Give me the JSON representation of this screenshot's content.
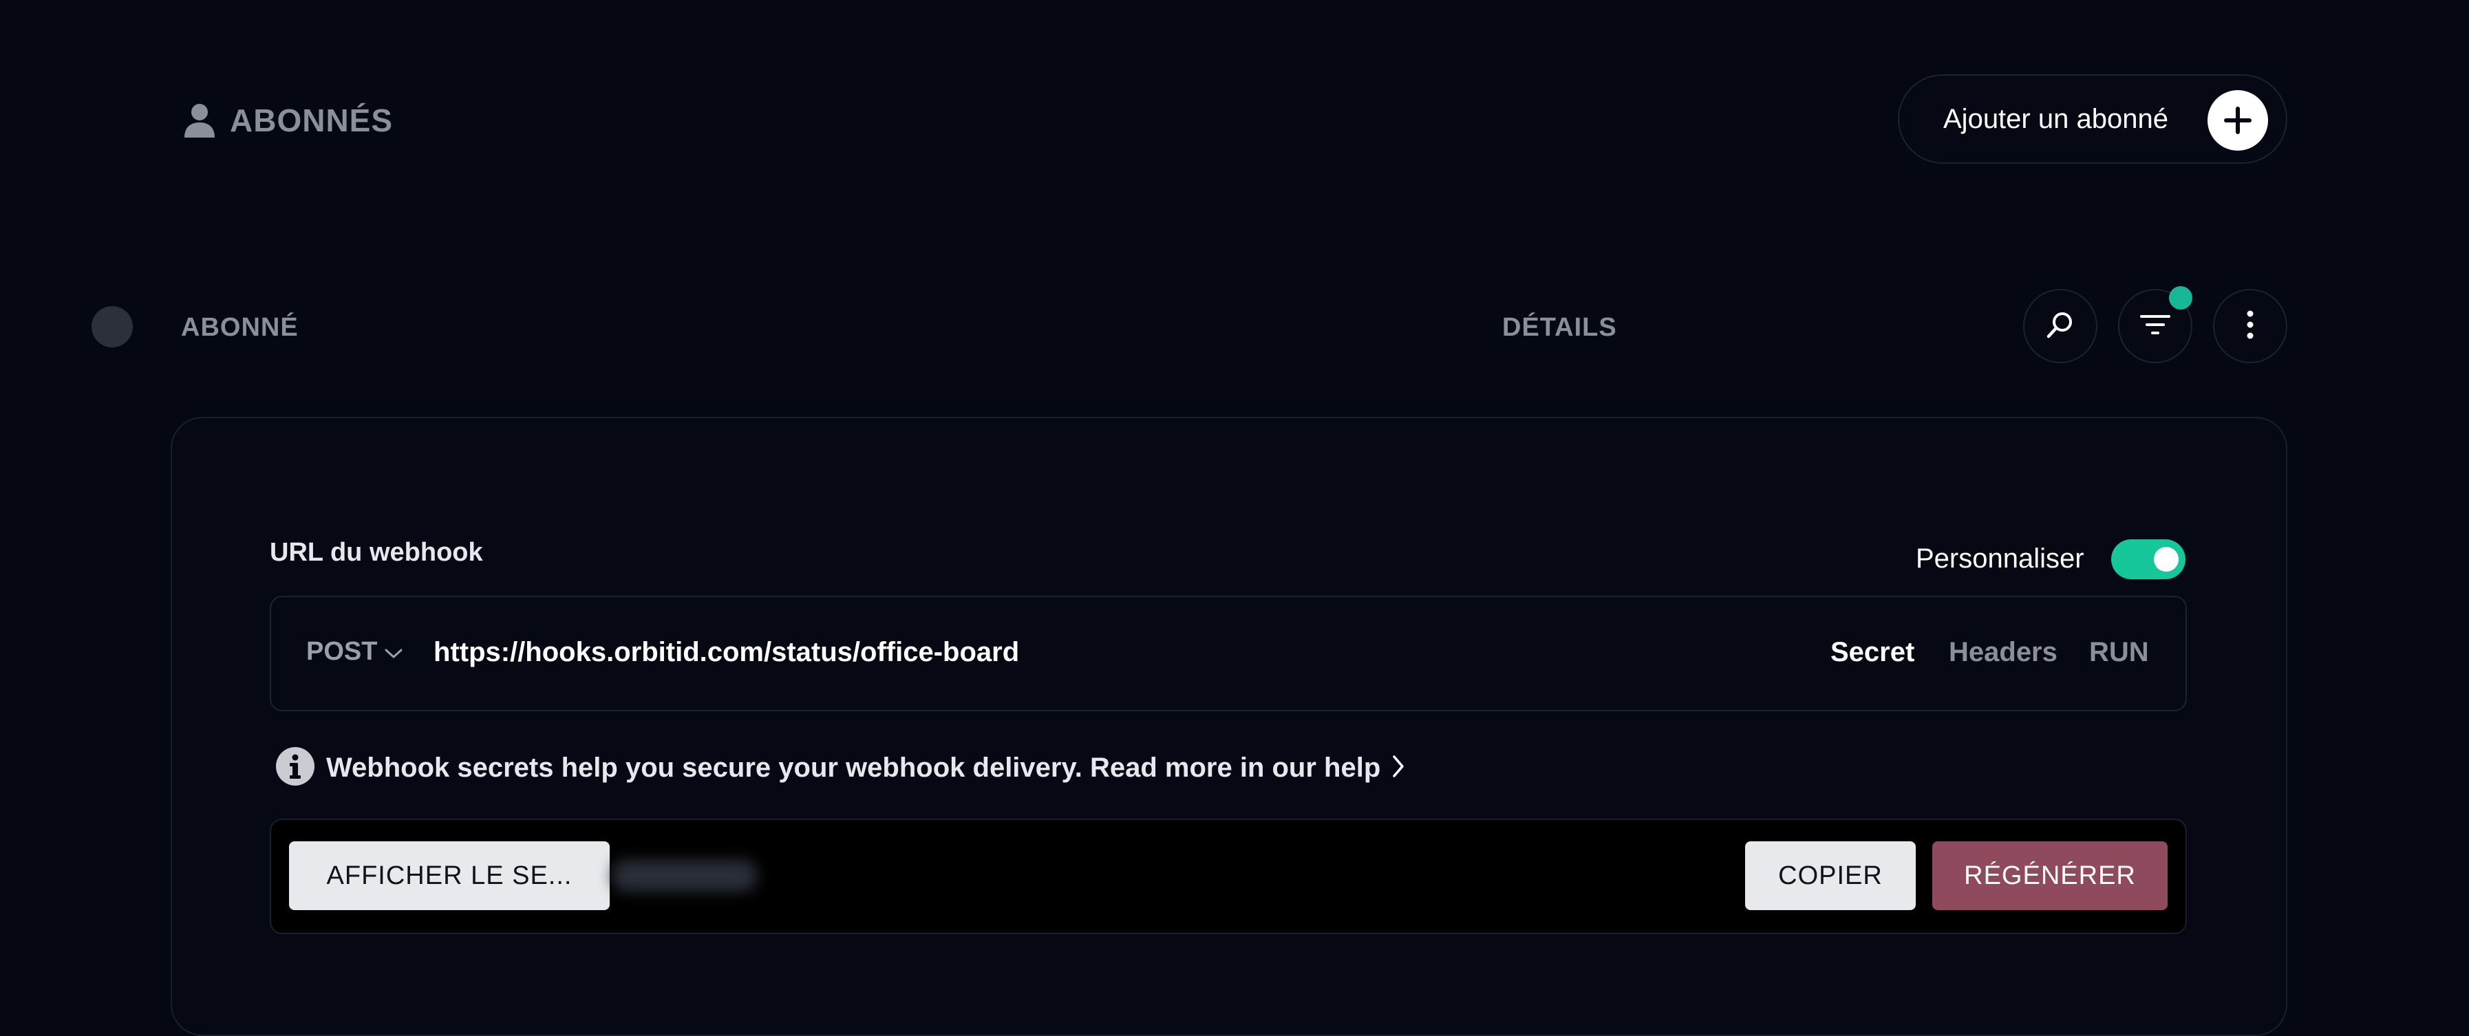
{
  "header": {
    "title": "ABONNÉS",
    "title_icon": "user-icon",
    "add_button_label": "Ajouter un abonné",
    "add_button_icon": "plus-icon"
  },
  "table": {
    "columns": [
      "ABONNÉ",
      "DÉTAILS"
    ],
    "actions": [
      "search-icon",
      "filter-icon",
      "more-vertical-icon"
    ],
    "filter_active": true
  },
  "webhook": {
    "label": "URL du webhook",
    "customize_label": "Personnaliser",
    "customize_enabled": true,
    "method": "POST",
    "url": "https://hooks.orbitid.com/status/office-board",
    "tabs": [
      "Secret",
      "Headers",
      "RUN"
    ],
    "active_tab": "Secret",
    "info_text": "Webhook secrets help you secure your webhook delivery. Read more in our help",
    "show_secret_label": "AFFICHER LE SE...",
    "copy_label": "COPIER",
    "regenerate_label": "RÉGÉNÉRER"
  },
  "colors": {
    "background": "#050813",
    "accent_green": "#16c79c",
    "regenerate": "#904a5d"
  }
}
